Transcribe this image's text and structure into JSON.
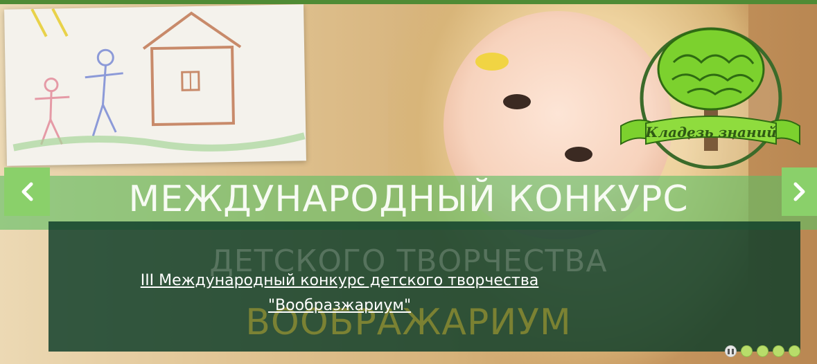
{
  "slider": {
    "headline_line1": "МЕЖДУНАРОДНЫЙ КОНКУРС",
    "headline_line2": "ДЕТСКОГО ТВОРЧЕСТВА",
    "headline_line3": "ВООБРАЖАРИУМ",
    "caption_line1": "III Международный конкурс детского творчества",
    "caption_line2": "\"Вообразжариум\"",
    "prev_icon": "chevron-left-icon",
    "next_icon": "chevron-right-icon",
    "dots": [
      "pause",
      "slide",
      "slide",
      "slide",
      "slide"
    ]
  },
  "logo": {
    "text": "Кладезь знаний",
    "icon": "brain-tree-logo"
  },
  "colors": {
    "accent_green": "#8ad06a",
    "band_green": "#5fbe64",
    "panel_dark": "#0e3e2a",
    "logo_green": "#7cd12e",
    "frame_green": "#4f8b35"
  }
}
